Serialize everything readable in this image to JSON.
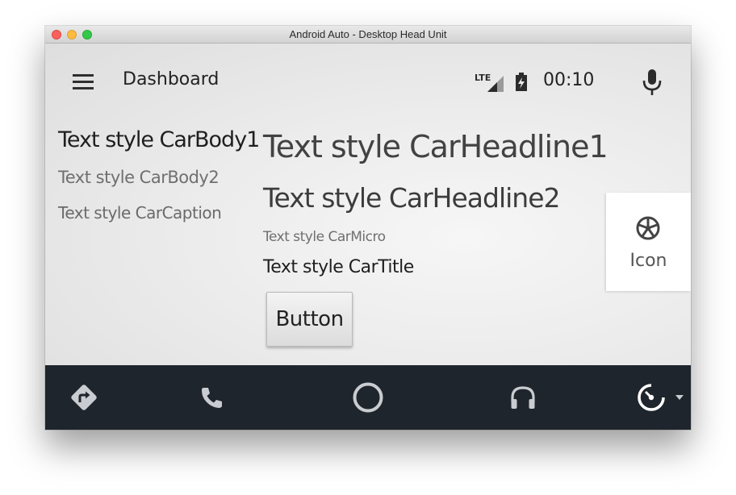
{
  "window": {
    "title": "Android Auto - Desktop Head Unit"
  },
  "appbar": {
    "title": "Dashboard",
    "menu_icon": "hamburger-menu-icon",
    "status": {
      "network_label": "LTE",
      "time": "00:10"
    },
    "mic_icon": "microphone-icon"
  },
  "content": {
    "body1": "Text style CarBody1",
    "body2": "Text style CarBody2",
    "caption": "Text style CarCaption",
    "headline1": "Text style CarHeadline1",
    "headline2": "Text style CarHeadline2",
    "micro": "Text style CarMicro",
    "title": "Text style CarTitle",
    "button_label": "Button",
    "icon_card_label": "Icon"
  },
  "navbar": {
    "items": [
      {
        "name": "navigation",
        "icon": "directions-icon"
      },
      {
        "name": "phone",
        "icon": "phone-icon"
      },
      {
        "name": "home",
        "icon": "home-circle-icon"
      },
      {
        "name": "media",
        "icon": "headphones-icon"
      },
      {
        "name": "dashboard",
        "icon": "speedometer-icon"
      }
    ]
  },
  "colors": {
    "navbar_bg": "#1f252c",
    "nav_icon": "#c9ccd0",
    "text_primary": "#222222",
    "text_secondary": "#6f6f6f"
  }
}
